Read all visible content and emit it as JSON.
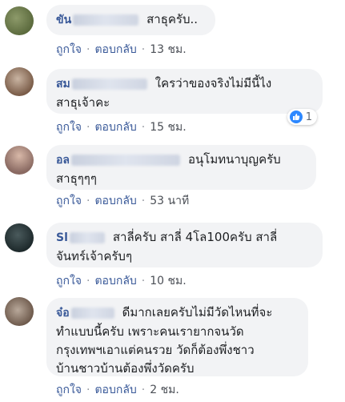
{
  "comments": [
    {
      "name": "ขัน",
      "text": "สาธุครับ..",
      "like_label": "ถูกใจ",
      "reply_label": "ตอบกลับ",
      "time": "13 ชม."
    },
    {
      "name": "สม",
      "text_line1": "ใครว่าของจริงไม่มีนี้ไง",
      "text_line2": "สาธุเจ้าคะ",
      "like_label": "ถูกใจ",
      "reply_label": "ตอบกลับ",
      "time": "15 ชม.",
      "reaction_count": "1"
    },
    {
      "name": "อล",
      "text_line1": "อนุโมทนาบุญครับ",
      "text_line2": "สาธุๆๆๆ",
      "like_label": "ถูกใจ",
      "reply_label": "ตอบกลับ",
      "time": "53 นาที"
    },
    {
      "name": "Sl",
      "text_line1": "สาลี่ครับ สาลี่ 4โล100ครับ สาลี่",
      "text_line2": "จันทร์เจ้าครับๆ",
      "like_label": "ถูกใจ",
      "reply_label": "ตอบกลับ",
      "time": "10 ชม."
    },
    {
      "name": "จ๋อ",
      "text_line1": "ดีมากเลยครับไม่มีวัดไหนที่จะ",
      "text_line2": "ทำแบบนี้ครับ เพราะคนเรายากจนวัด",
      "text_line3": "กรุงเทพฯเอาแต่คนรวย วัดก็ต้องพึ่งชาว",
      "text_line4": "บ้านชาวบ้านต้องพึ่งวัดครับ",
      "like_label": "ถูกใจ",
      "reply_label": "ตอบกลับ",
      "time": "2 ชม."
    }
  ],
  "separator": "·",
  "colors": {
    "name": "#385898",
    "bubble": "#f2f3f5",
    "like_blue": "#2d88ff"
  }
}
